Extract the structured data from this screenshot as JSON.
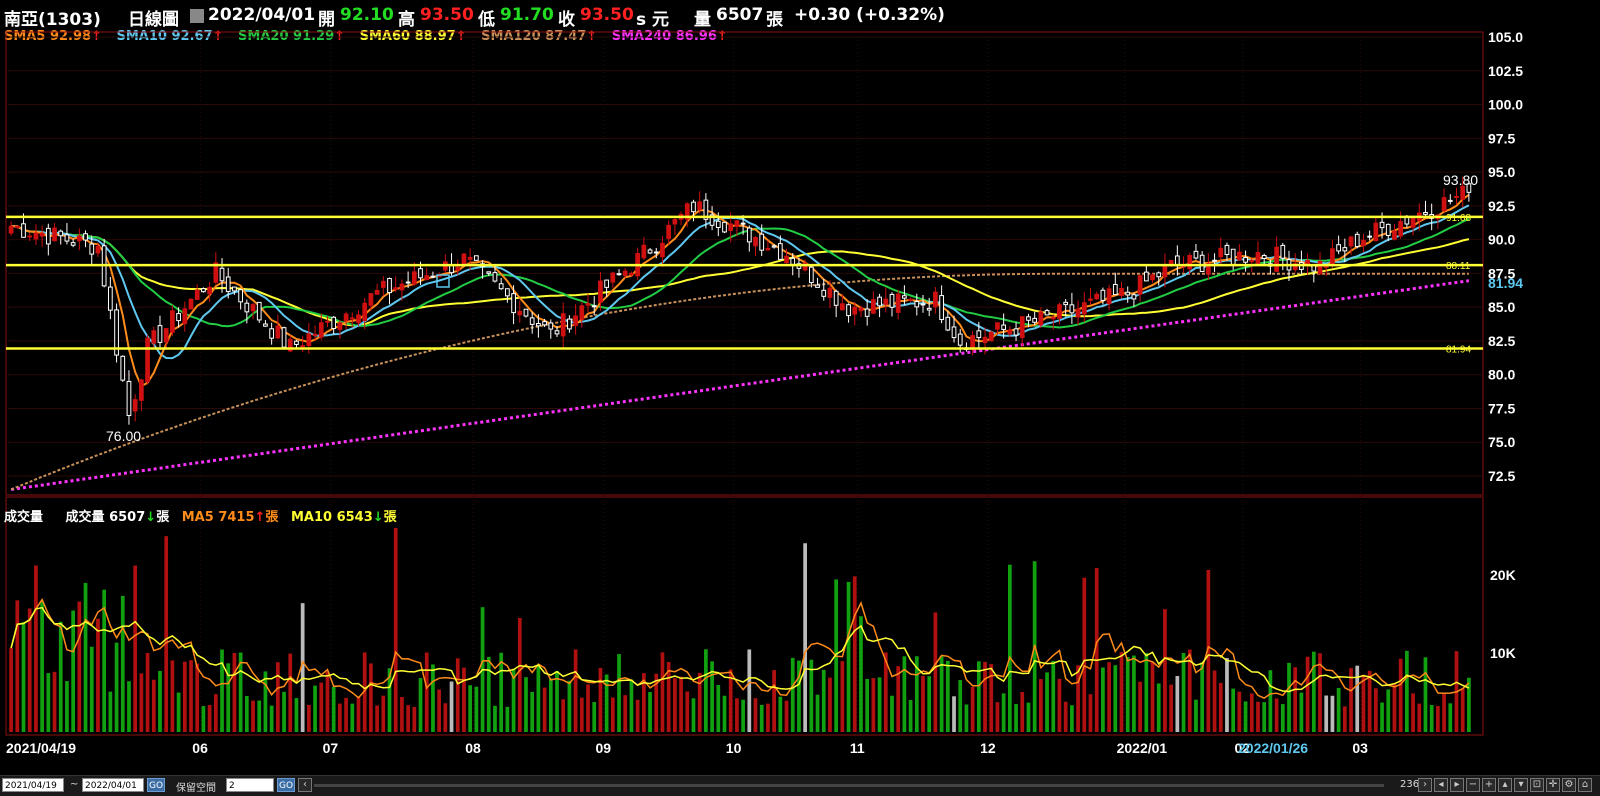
{
  "header": {
    "stock": "南亞(1303)",
    "period": "日線圖",
    "dropdown_icon": "chevron-down-icon",
    "date": "2022/04/01",
    "open_label": "開",
    "open": "92.10",
    "high_label": "高",
    "high": "93.50",
    "low_label": "低",
    "low": "91.70",
    "close_label": "收",
    "close": "93.50",
    "currency": "s 元",
    "volume_label": "量",
    "volume": "6507",
    "volume_unit": "張",
    "change": "+0.30 (+0.32%)"
  },
  "ma_legend": [
    {
      "name": "SMA5",
      "value": "92.98",
      "color": "#ff8c1a"
    },
    {
      "name": "SMA10",
      "value": "92.67",
      "color": "#5fc8f0"
    },
    {
      "name": "SMA20",
      "value": "91.29",
      "color": "#22cc44"
    },
    {
      "name": "SMA60",
      "value": "88.97",
      "color": "#ffff33"
    },
    {
      "name": "SMA120",
      "value": "87.47",
      "color": "#c8915a"
    },
    {
      "name": "SMA240",
      "value": "86.96",
      "color": "#ff33ff"
    }
  ],
  "volume_legend": {
    "title": "成交量",
    "vol_label": "成交量",
    "vol_value": "6507",
    "ma5_label": "MA5",
    "ma5_value": "7415",
    "ma10_label": "MA10",
    "ma10_value": "6543",
    "unit": "張"
  },
  "price_axis": [
    "105.0",
    "102.5",
    "100.0",
    "97.5",
    "95.0",
    "92.5",
    "90.0",
    "87.5",
    "85.0",
    "82.5",
    "80.0",
    "77.5",
    "75.0",
    "72.5"
  ],
  "volume_axis": [
    "20K",
    "10K"
  ],
  "date_axis": [
    "2021/04/19",
    "06",
    "07",
    "08",
    "09",
    "10",
    "11",
    "12",
    "2022/01",
    "02",
    "03"
  ],
  "cursor_date": "2022/01/26",
  "annotations": {
    "high_mark": "93.80",
    "low_mark": "76.00",
    "right_value": "81.94"
  },
  "horizontal_lines": [
    {
      "value": 91.68,
      "label": "91.68"
    },
    {
      "value": 88.11,
      "label": "88.11"
    },
    {
      "value": 81.94,
      "label": "81.94"
    }
  ],
  "colors": {
    "up": "#d01010",
    "down": "#10b010",
    "hline": "#ffff33",
    "text": "#ffffff"
  },
  "statusbar": {
    "start_date": "2021/04/19",
    "tilde": "~",
    "end_date": "2022/04/01",
    "go_label": "GO",
    "keep_label": "保留空間",
    "keep_value": "2",
    "count": "236"
  },
  "chart_data": {
    "type": "candlestick",
    "ylim": [
      71.5,
      106
    ],
    "anchors": [
      {
        "date": "2021/04/19",
        "close": 91
      },
      {
        "date": "2021/05/10",
        "close": 89.5
      },
      {
        "date": "2021/05/17",
        "close": 77
      },
      {
        "date": "2021/05/21",
        "close": 82
      },
      {
        "date": "2021/06/07",
        "close": 87.5
      },
      {
        "date": "2021/06/25",
        "close": 82
      },
      {
        "date": "2021/07/15",
        "close": 86
      },
      {
        "date": "2021/08/05",
        "close": 88.5
      },
      {
        "date": "2021/08/25",
        "close": 83
      },
      {
        "date": "2021/09/15",
        "close": 88.5
      },
      {
        "date": "2021/09/28",
        "close": 92.5
      },
      {
        "date": "2021/10/20",
        "close": 89
      },
      {
        "date": "2021/11/05",
        "close": 85
      },
      {
        "date": "2021/11/25",
        "close": 85.5
      },
      {
        "date": "2021/12/01",
        "close": 82.5
      },
      {
        "date": "2021/12/20",
        "close": 84
      },
      {
        "date": "2022/01/10",
        "close": 86
      },
      {
        "date": "2022/01/20",
        "close": 88
      },
      {
        "date": "2022/02/10",
        "close": 89
      },
      {
        "date": "2022/02/25",
        "close": 88
      },
      {
        "date": "2022/03/05",
        "close": 90
      },
      {
        "date": "2022/04/01",
        "close": 93.5
      }
    ],
    "volume_range": [
      0,
      27000
    ],
    "sma240_range": [
      71.5,
      86.96
    ],
    "sma120_range": [
      71.5,
      87.47
    ]
  }
}
